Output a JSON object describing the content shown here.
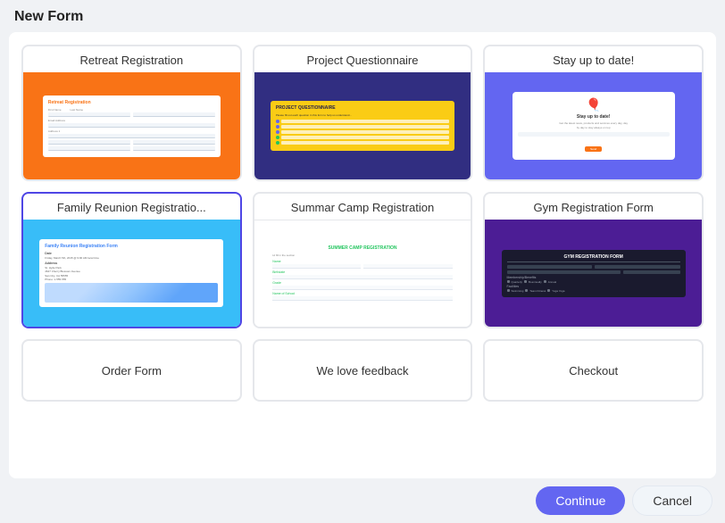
{
  "page": {
    "title": "New Form"
  },
  "cards": [
    {
      "id": "retreat-registration",
      "label": "Retreat Registration",
      "preview_type": "retreat",
      "selected": false
    },
    {
      "id": "project-questionnaire",
      "label": "Project Questionnaire",
      "preview_type": "project",
      "selected": false
    },
    {
      "id": "stay-up-to-date",
      "label": "Stay up to date!",
      "preview_type": "stayuptodate",
      "selected": false
    },
    {
      "id": "family-reunion-registration",
      "label": "Family Reunion Registratio...",
      "preview_type": "family",
      "selected": true
    },
    {
      "id": "summer-camp-registration",
      "label": "Summar Camp Registration",
      "preview_type": "summercamp",
      "selected": false
    },
    {
      "id": "gym-registration-form",
      "label": "Gym Registration Form",
      "preview_type": "gym",
      "selected": false
    }
  ],
  "bottom_cards": [
    {
      "id": "order-form",
      "label": "Order Form"
    },
    {
      "id": "we-love-feedback",
      "label": "We love feedback"
    },
    {
      "id": "checkout",
      "label": "Checkout"
    }
  ],
  "buttons": {
    "continue": "Continue",
    "cancel": "Cancel"
  }
}
